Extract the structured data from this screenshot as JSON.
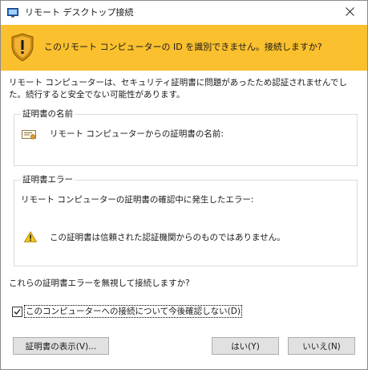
{
  "window": {
    "title": "リモート デスクトップ接続"
  },
  "banner": {
    "message": "このリモート コンピューターの ID を識別できません。接続しますか?",
    "color": "#fbc02d"
  },
  "description": "リモート コンピューターは、セキュリティ証明書に問題があったため認証されませんでした。続行すると安全でない可能性があります。",
  "cert_group": {
    "title": "証明書の名前",
    "name_label": "リモート コンピューターからの証明書の名前:"
  },
  "error_group": {
    "title": "証明書エラー",
    "description": "リモート コンピューターの証明書の確認中に発生したエラー:",
    "message": "この証明書は信頼された認証機関からのものではありません。"
  },
  "question": "これらの証明書エラーを無視して接続しますか?",
  "checkbox": {
    "label": "このコンピューターへの接続について今後確認しない(D)",
    "checked": true
  },
  "buttons": {
    "view_certificate": "証明書の表示(V)...",
    "yes": "はい(Y)",
    "no": "いいえ(N)"
  },
  "icons": {
    "app": "remote-desktop-icon",
    "close": "close-icon",
    "shield": "warning-shield-icon",
    "certificate": "certificate-icon",
    "warning": "warning-triangle-icon"
  }
}
